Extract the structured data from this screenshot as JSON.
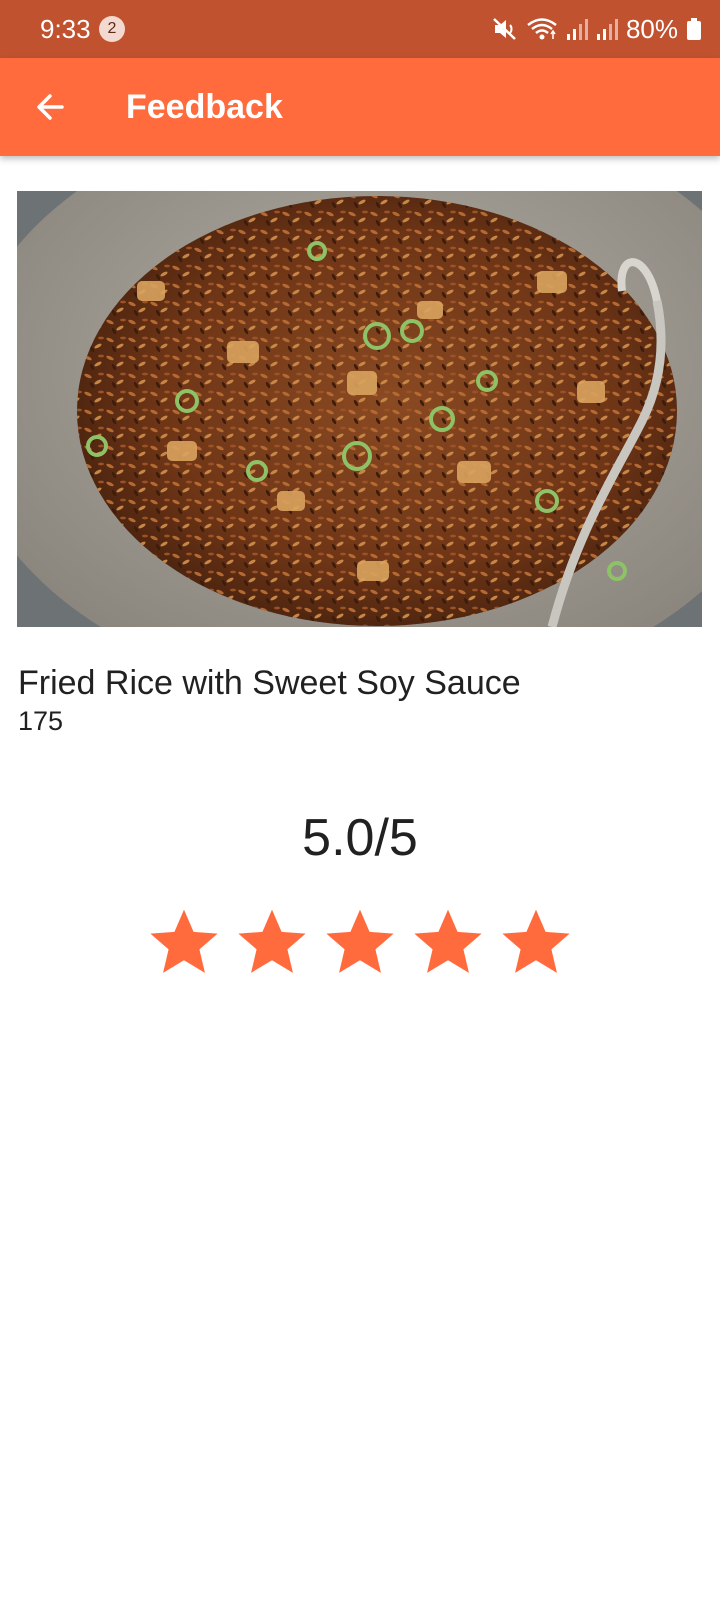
{
  "status_bar": {
    "time": "9:33",
    "notification_count": "2",
    "battery": "80%",
    "icons": [
      "mute-icon",
      "wifi-icon",
      "signal-icon",
      "signal-icon",
      "battery-icon"
    ]
  },
  "app_bar": {
    "title": "Feedback",
    "back_icon": "arrow-left-icon",
    "color": "#ff6b3d"
  },
  "dish": {
    "name": "Fried Rice with Sweet Soy Sauce",
    "subtitle": "175",
    "image": "fried-rice-photo"
  },
  "rating": {
    "display": "5.0/5",
    "value": 5.0,
    "max": 5,
    "star_color": "#ff6b3d"
  }
}
